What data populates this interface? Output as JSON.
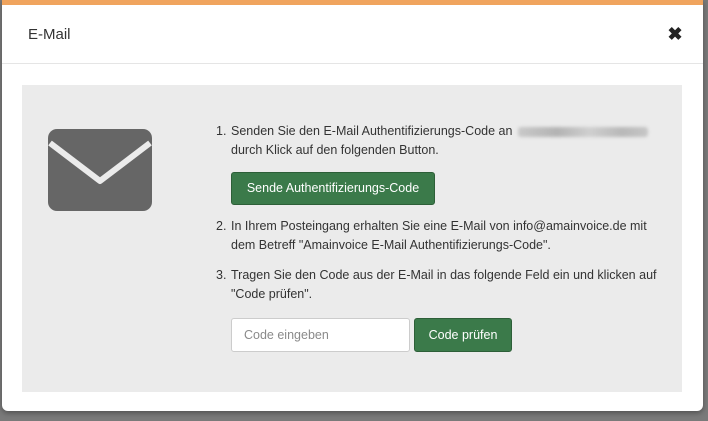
{
  "modal": {
    "title": "E-Mail",
    "close_glyph": "✖",
    "icon": "envelope-icon",
    "steps": [
      {
        "num": "1.",
        "text": "Senden Sie den E-Mail Authentifizierungs-Code an",
        "text_cont": "durch Klick auf den folgenden Button."
      },
      {
        "num": "2.",
        "text": "In Ihrem Posteingang erhalten Sie eine E-Mail von info@amainvoice.de mit dem Betreff \"Amainvoice E-Mail Authentifizierungs-Code\"."
      },
      {
        "num": "3.",
        "text": "Tragen Sie den Code aus der E-Mail in das folgende Feld ein und klicken auf \"Code prüfen\"."
      }
    ],
    "send_button": "Sende Authentifizierungs-Code",
    "code_placeholder": "Code eingeben",
    "check_button": "Code prüfen"
  },
  "colors": {
    "accent_top": "#f0a45e",
    "button_green": "#3b7a4a",
    "well_bg": "#ebebeb",
    "icon_gray": "#666666"
  }
}
